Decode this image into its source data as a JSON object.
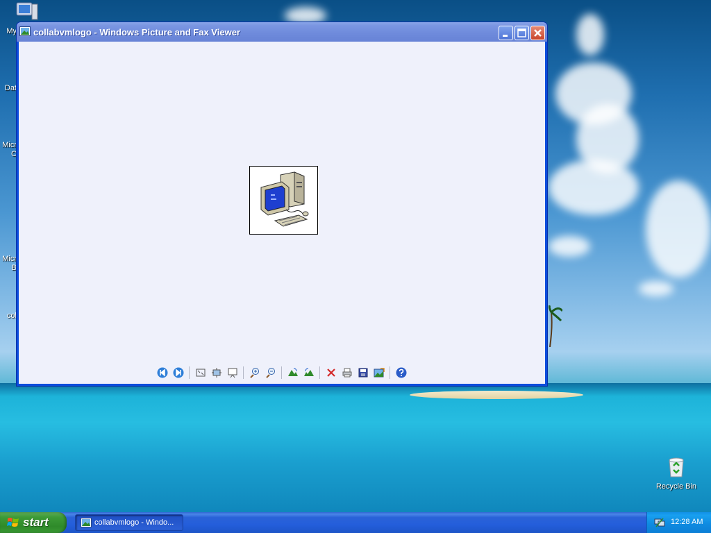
{
  "desktop": {
    "left_labels": [
      "My",
      "Dat",
      "Micr",
      "C",
      "Micr",
      "B",
      "col"
    ],
    "recycle_bin_label": "Recycle Bin"
  },
  "window": {
    "title": "collabvmlogo - Windows Picture and Fax Viewer",
    "image_icon": "computer-icon",
    "toolbar_icons": [
      "previous-image-icon",
      "next-image-icon",
      "best-fit-icon",
      "actual-size-icon",
      "slideshow-icon",
      "zoom-in-icon",
      "zoom-out-icon",
      "rotate-clockwise-icon",
      "rotate-counterclockwise-icon",
      "delete-icon",
      "print-icon",
      "save-icon",
      "open-for-editing-icon",
      "help-icon"
    ]
  },
  "taskbar": {
    "start_label": "start",
    "task_label": "collabvmlogo - Windo...",
    "clock": "12:28 AM"
  },
  "colors": {
    "titlebar": "#7c97e2",
    "client_bg": "#eff1fb",
    "taskbar": "#245edb",
    "start_green": "#3c9a36",
    "tray": "#0e8ae0"
  }
}
